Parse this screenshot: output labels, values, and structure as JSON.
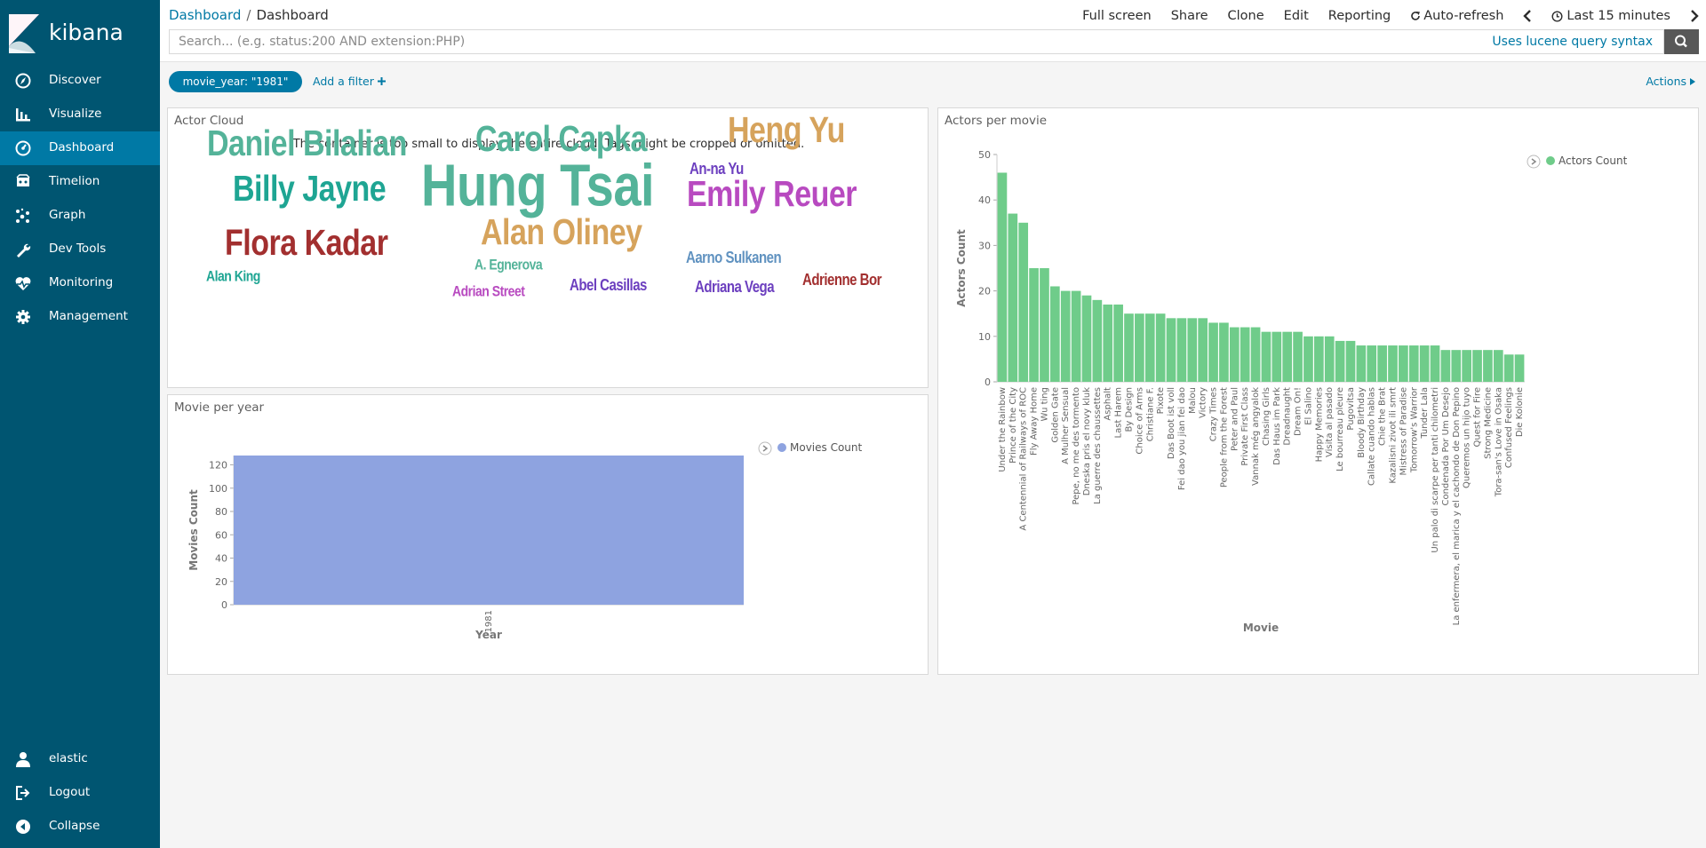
{
  "app": {
    "name": "kibana"
  },
  "sidebar": {
    "items": [
      {
        "label": "Discover",
        "icon": "compass-icon"
      },
      {
        "label": "Visualize",
        "icon": "bar-chart-icon"
      },
      {
        "label": "Dashboard",
        "icon": "dashboard-icon",
        "active": true
      },
      {
        "label": "Timelion",
        "icon": "timelion-icon"
      },
      {
        "label": "Graph",
        "icon": "graph-icon"
      },
      {
        "label": "Dev Tools",
        "icon": "wrench-icon"
      },
      {
        "label": "Monitoring",
        "icon": "heartbeat-icon"
      },
      {
        "label": "Management",
        "icon": "gear-icon"
      }
    ],
    "bottom": [
      {
        "label": "elastic",
        "icon": "user-icon"
      },
      {
        "label": "Logout",
        "icon": "logout-icon"
      },
      {
        "label": "Collapse",
        "icon": "collapse-icon"
      }
    ]
  },
  "header": {
    "breadcrumb": [
      "Dashboard",
      "Dashboard"
    ],
    "menu": [
      "Full screen",
      "Share",
      "Clone",
      "Edit",
      "Reporting"
    ],
    "auto_refresh": "Auto-refresh",
    "time_range": "Last 15 minutes"
  },
  "search": {
    "placeholder": "Search... (e.g. status:200 AND extension:PHP)",
    "value": "",
    "syntax_link": "Uses lucene query syntax"
  },
  "filters": {
    "pill": "movie_year: \"1981\"",
    "add_label": "Add a filter",
    "actions_label": "Actions"
  },
  "panels": {
    "cloud": {
      "title": "Actor Cloud",
      "warning": "The container is too small to display the entire cloud. Tags might be cropped or omitted.",
      "tags": [
        {
          "text": "Daniel Bilalian",
          "color": "#54b399"
        },
        {
          "text": "Carol Capka",
          "color": "#54b399"
        },
        {
          "text": "Heng Yu",
          "color": "#d6a35c"
        },
        {
          "text": "An-na Yu",
          "color": "#6c3fbf"
        },
        {
          "text": "Billy Jayne",
          "color": "#1ea593"
        },
        {
          "text": "Hung Tsai",
          "color": "#54b399"
        },
        {
          "text": "Emily Reuer",
          "color": "#b84ac0"
        },
        {
          "text": "Flora Kadar",
          "color": "#a22f2f"
        },
        {
          "text": "Alan Oliney",
          "color": "#d6a35c"
        },
        {
          "text": "Aarno Sulkanen",
          "color": "#6092c0"
        },
        {
          "text": "Alan King",
          "color": "#1ea593"
        },
        {
          "text": "A. Egnerova",
          "color": "#54b399"
        },
        {
          "text": "Adrian Street",
          "color": "#b84ac0"
        },
        {
          "text": "Abel Casillas",
          "color": "#6c3fbf"
        },
        {
          "text": "Adriana Vega",
          "color": "#6c3fbf"
        },
        {
          "text": "Adrienne Bor",
          "color": "#a22f2f"
        }
      ]
    },
    "movie_year": {
      "title": "Movie per year",
      "legend": "Movies Count",
      "series_color": "#8ea3e0"
    },
    "actors": {
      "title": "Actors per movie",
      "legend": "Actors Count",
      "series_color": "#6fcc8a"
    }
  },
  "chart_data": [
    {
      "type": "bar",
      "title": "Movie per year",
      "categories": [
        "1981"
      ],
      "series": [
        {
          "name": "Movies Count",
          "values": [
            128
          ]
        }
      ],
      "xlabel": "Year",
      "ylabel": "Movies Count",
      "ylim": [
        0,
        128
      ],
      "yticks": [
        0,
        20,
        40,
        60,
        80,
        100,
        120
      ],
      "legend": "right"
    },
    {
      "type": "bar",
      "title": "Actors per movie",
      "categories": [
        "Under the Rainbow",
        "Prince of the City",
        "A Centennial of Railways of ROC",
        "Fly Away Home",
        "Wu ting",
        "Golden Gate",
        "A Mulher Sensual",
        "Pepe, no me des tormento",
        "Dneska pris el novy kluk",
        "La guerre des chaussettes",
        "Asphalt",
        "Last Harem",
        "By Design",
        "Choice of Arms",
        "Christiane F.",
        "Pixote",
        "Das Boot ist voll",
        "Fei dao you jian fei dao",
        "Malou",
        "Victory",
        "Crazy Times",
        "People from the Forest",
        "Peter and Paul",
        "Private First Class",
        "Vannak még angyalok",
        "Chasing Girls",
        "Das Haus im Park",
        "Dreadnaught",
        "Dream On!",
        "El Salino",
        "Happy Memories",
        "Visita al pasado",
        "Le bourreau pleure",
        "Pugovitsa",
        "Bloody Birthday",
        "Callate cuando hablas",
        "Chie the Brat",
        "Kazalisni zivot ili smrt",
        "Mistress of Paradise",
        "Tomorrow's Warrior",
        "Tunder Lala",
        "Un palo di scarpe per tanti chilometri",
        "Condenada Por Um Desejo",
        "La enfermera, el marica y el cachondo de Don Pepino",
        "Queremos un hijo tuyo",
        "Quest for Fire",
        "Strong Medicine",
        "Tora-san's Love in Osaka",
        "Confused Feelings",
        "Die Kolonie"
      ],
      "series": [
        {
          "name": "Actors Count",
          "values": [
            46,
            37,
            35,
            25,
            25,
            21,
            20,
            20,
            19,
            18,
            17,
            17,
            15,
            15,
            15,
            15,
            14,
            14,
            14,
            14,
            13,
            13,
            12,
            12,
            12,
            11,
            11,
            11,
            11,
            10,
            10,
            10,
            9,
            9,
            8,
            8,
            8,
            8,
            8,
            8,
            8,
            8,
            7,
            7,
            7,
            7,
            7,
            7,
            6,
            6
          ]
        }
      ],
      "xlabel": "Movie",
      "ylabel": "Actors Count",
      "ylim": [
        0,
        50
      ],
      "yticks": [
        0,
        10,
        20,
        30,
        40,
        50
      ],
      "legend": "top-right"
    }
  ]
}
